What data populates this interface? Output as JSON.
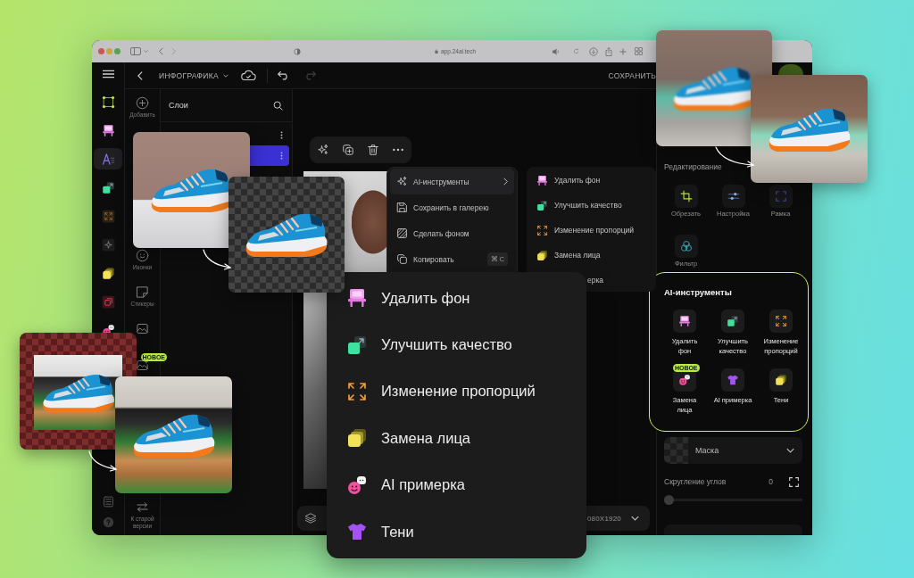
{
  "browser": {
    "url": "app.24ai.tech"
  },
  "topbar": {
    "title": "ИНФОГРАФИКА",
    "save_label": "СОХРАНИТЬ"
  },
  "rail": {
    "items": [
      {
        "kind": "frame",
        "selected": false
      },
      {
        "kind": "remove_bg",
        "selected": false
      },
      {
        "kind": "text",
        "selected": true
      },
      {
        "kind": "enhance",
        "selected": false
      },
      {
        "kind": "resize_tile",
        "selected": false
      },
      {
        "kind": "sparkle_tile",
        "selected": false
      },
      {
        "kind": "squares",
        "selected": false
      },
      {
        "kind": "gallery",
        "selected": false
      },
      {
        "kind": "faces",
        "selected": false
      }
    ],
    "bottom": [
      {
        "kind": "list"
      },
      {
        "kind": "help"
      }
    ]
  },
  "tools": {
    "items": [
      {
        "kind": "add",
        "label": "Добавить"
      },
      {
        "kind": "emoji",
        "label": "Иконки"
      },
      {
        "kind": "sticker",
        "label": "Стикеры"
      },
      {
        "kind": "image"
      },
      {
        "kind": "image_plus",
        "badge": "НОВОЕ"
      }
    ],
    "legacy": {
      "kind": "swap",
      "label": "К старой версии"
    }
  },
  "layers": {
    "title": "Слои",
    "rows": [
      {
        "selected": false
      },
      {
        "selected": true
      }
    ]
  },
  "toolbar": {
    "items": [
      {
        "kind": "sparkle"
      },
      {
        "kind": "duplicate"
      },
      {
        "kind": "trash"
      },
      {
        "kind": "more"
      }
    ]
  },
  "context_menu": {
    "items": [
      {
        "kind": "sparkle",
        "label": "AI-инструменты",
        "submenu": true,
        "selected": true
      },
      {
        "kind": "save",
        "label": "Сохранить в галерею",
        "selected": false
      },
      {
        "kind": "hatch",
        "label": "Сделать фоном",
        "selected": false
      },
      {
        "kind": "copy",
        "label": "Копировать",
        "shortcut": "⌘ C",
        "selected": false
      }
    ]
  },
  "submenu": {
    "items": [
      {
        "kind": "remove_bg",
        "label": "Удалить фон"
      },
      {
        "kind": "enhance",
        "label": "Улучшить качество"
      },
      {
        "kind": "resize",
        "label": "Изменение пропорций"
      },
      {
        "kind": "squares",
        "label": "Замена лица"
      },
      {
        "label": "ерка"
      }
    ]
  },
  "bottom_bar": {
    "size": "080X1920"
  },
  "big_menu": {
    "items": [
      {
        "kind": "remove_bg",
        "label": "Удалить фон"
      },
      {
        "kind": "enhance",
        "label": "Улучшить качество"
      },
      {
        "kind": "resize",
        "label": "Изменение пропорций"
      },
      {
        "kind": "squares",
        "label": "Замена лица"
      },
      {
        "kind": "faces",
        "label": "AI примерка"
      },
      {
        "kind": "shirt",
        "label": "Тени"
      }
    ]
  },
  "editing": {
    "title": "Редактирование",
    "tools": [
      {
        "kind": "crop",
        "label": "Обрезать"
      },
      {
        "kind": "adjust",
        "label": "Настройка"
      },
      {
        "kind": "border",
        "label": "Рамка"
      },
      {
        "kind": "filter",
        "label": "Фильтр"
      }
    ]
  },
  "ai_tools": {
    "title": "AI-инструменты",
    "tools": [
      {
        "kind": "remove_bg",
        "label": "Удалить\nфон"
      },
      {
        "kind": "enhance",
        "label": "Улучшить\nкачество"
      },
      {
        "kind": "resize",
        "label": "Изменение\nпропорций"
      },
      {
        "kind": "faces",
        "label": "Замена\nлица",
        "badge": "НОВОЕ"
      },
      {
        "kind": "shirt",
        "label": "AI примерка"
      },
      {
        "kind": "squares",
        "label": "Тени"
      }
    ]
  },
  "mask": {
    "label": "Маска"
  },
  "corner_radius": {
    "label": "Скругление углов",
    "value": "0",
    "level": 0
  }
}
